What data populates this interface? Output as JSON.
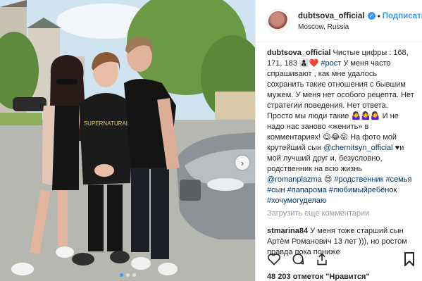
{
  "post": {
    "username": "dubtsova_official",
    "dot": "•",
    "follow_label": "Подписаться",
    "location": "Moscow, Russia",
    "caption_text_1": "Чистые цифры : 168, 171, 183 ",
    "caption_emoji_1": "👩‍👦‍👦❤️",
    "caption_tag_1": "#рост",
    "caption_text_2": "У меня часто спрашивают , как мне удалось сохранить такие отношения с бывшим мужем. У меня нет особого рецепта. Нет стратегии поведения. Нет ответа. Просто мы люди такие ",
    "caption_emoji_2": "🤷‍♀️🤷‍♀️🤷‍♀️",
    "caption_text_3": " И не надо нас заново «женить» в комментариях! ",
    "caption_emoji_3": "😉😂😜",
    "caption_text_4": " На фото мой крутейший сын ",
    "caption_mention_1": "@chernitsyn_official",
    "caption_text_5": " ♥и мой лучший друг и, безусловно, родственник на всю жизнь ",
    "caption_mention_2": "@romanplazma",
    "caption_emoji_4": " 😍",
    "caption_tags_2": "#родственник #семья #сын #папарома #любимыйребёнок #хочумогуделаю",
    "load_more_label": "Загрузить еще комментарии",
    "comment_user": "stmarina84",
    "comment_text": "У меня тоже старший сын Артём Романович 13 лет ))), но ростом правда пока пониже",
    "likes_text": "48 203 отметок \"Нравится\""
  },
  "photo": {
    "shirt_print": "SUPERNATURAL"
  },
  "carousel": {
    "total": 3,
    "active": 1
  },
  "icons": {
    "like": "heart-icon",
    "comment": "comment-icon",
    "share": "share-icon",
    "save": "bookmark-icon",
    "next": "chevron-right-icon"
  },
  "colors": {
    "accent": "#3897f0",
    "text": "#262626",
    "muted": "#999999",
    "link": "#003569"
  }
}
